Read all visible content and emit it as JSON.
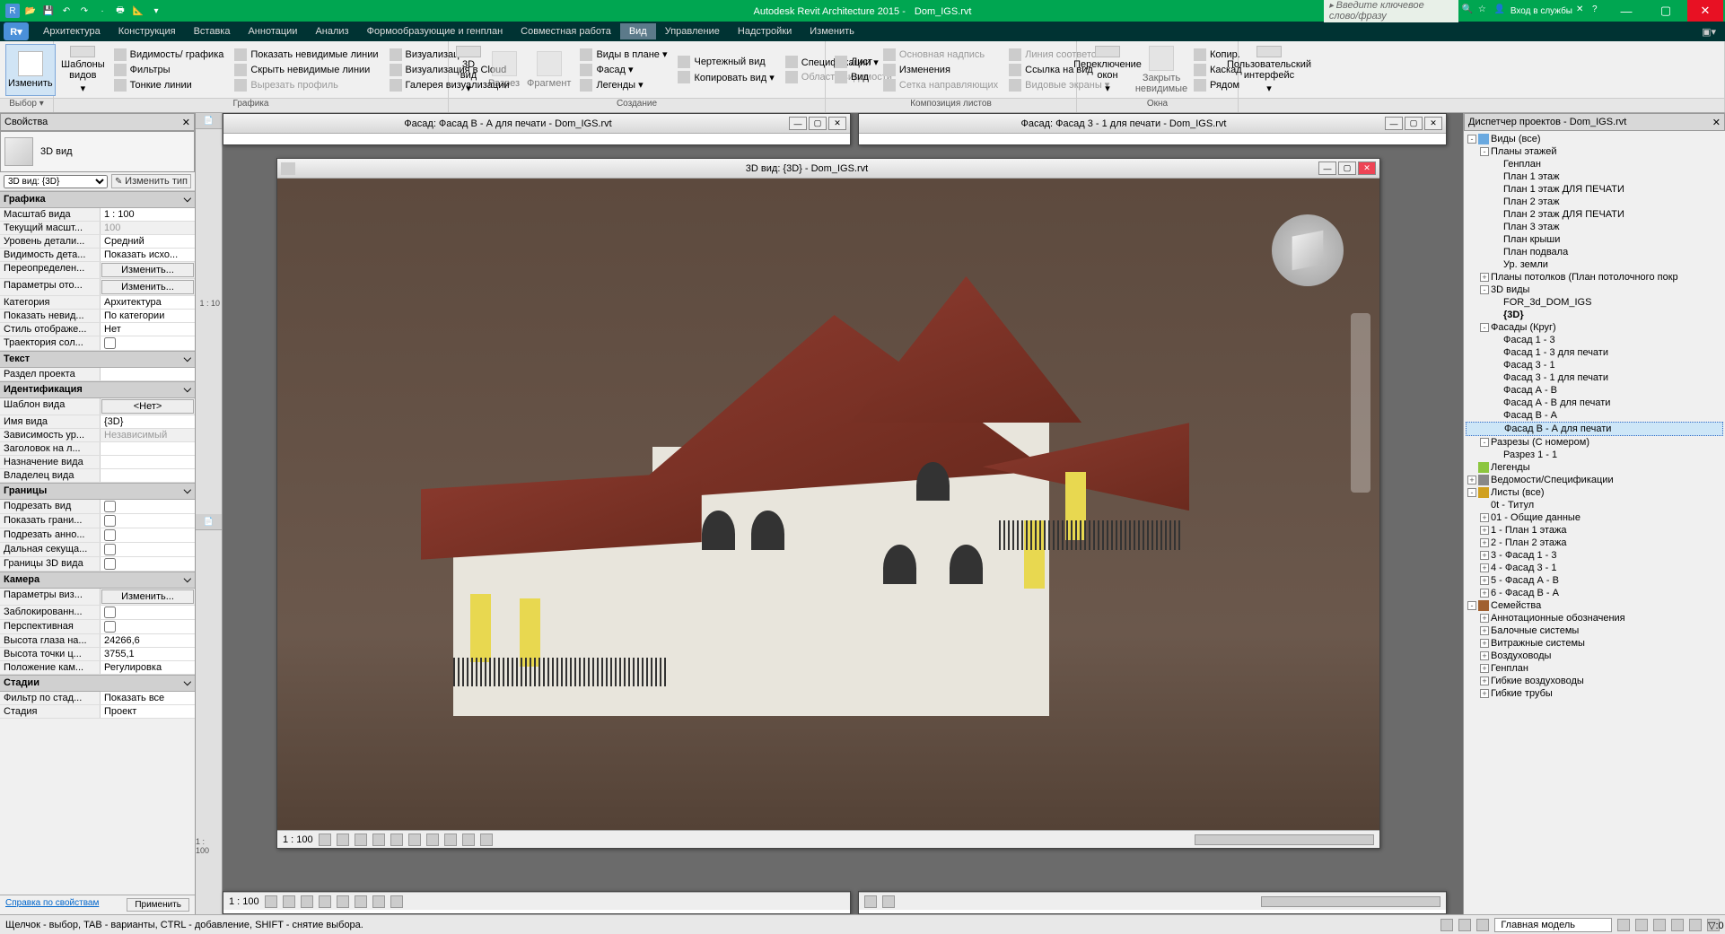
{
  "title_app": "Autodesk Revit Architecture 2015 -",
  "title_file": "Dom_IGS.rvt",
  "search_placeholder": "Введите ключевое слово/фразу",
  "login_label": "Вход в службы",
  "menu_tabs": [
    "Архитектура",
    "Конструкция",
    "Вставка",
    "Аннотации",
    "Анализ",
    "Формообразующие и генплан",
    "Совместная работа",
    "Вид",
    "Управление",
    "Надстройки",
    "Изменить"
  ],
  "menu_active_index": 7,
  "ribbon": {
    "g_select": {
      "label": "Выбор ▾",
      "btn_modify": "Изменить"
    },
    "g_graphics": {
      "label": "Графика",
      "btn_templates": "Шаблоны видов",
      "r1": "Видимость/ графика",
      "r2": "Фильтры",
      "r3": "Тонкие линии",
      "r4": "Показать невидимые линии",
      "r5": "Скрыть невидимые линии",
      "r6": "Вырезать профиль",
      "r7": "Визуализация",
      "r8": "Визуализация  в Cloud",
      "r9": "Галерея  визуализации"
    },
    "g_create": {
      "label": "Создание",
      "btn_3d": "3D вид",
      "btn_section": "Разрез",
      "btn_fragment": "Фрагмент",
      "r1": "Виды в плане  ▾",
      "r2": "Фасад  ▾",
      "r3": "Легенды ▾",
      "r4": "Чертежный вид",
      "r5": "Копировать вид  ▾",
      "r6": "Спецификации  ▾",
      "r7": "Область видимости"
    },
    "g_sheet": {
      "label": "Композиция листов",
      "r1": "Лист",
      "r2": "Вид",
      "r3": "Основная надпись",
      "r4": "Изменения",
      "r5": "Сетка направляющих",
      "r6": "Линия соответствия",
      "r7": "Ссылка на вид",
      "r8": "Видовые экраны  ▾"
    },
    "g_windows": {
      "label": "Окна",
      "btn_switch": "Переключение окон",
      "btn_close": "Закрыть невидимые",
      "r1": "Копир.",
      "r2": "Каскад",
      "r3": "Рядом",
      "btn_ui": "Пользовательский интерфейс"
    }
  },
  "props": {
    "header": "Свойства",
    "type_label": "3D вид",
    "dropdown": "3D вид: {3D}",
    "edit_type": "Изменить тип",
    "cats": {
      "graphics": "Графика",
      "text": "Текст",
      "ident": "Идентификация",
      "bounds": "Границы",
      "camera": "Камера",
      "stages": "Стадии"
    },
    "items": {
      "scale": {
        "k": "Масштаб вида",
        "v": "1 : 100"
      },
      "cur_scale": {
        "k": "Текущий масшт...",
        "v": "100"
      },
      "detail": {
        "k": "Уровень детали...",
        "v": "Средний"
      },
      "visibility": {
        "k": "Видимость дета...",
        "v": "Показать исхо..."
      },
      "override": {
        "k": "Переопределен...",
        "v": "Изменить..."
      },
      "display_params": {
        "k": "Параметры ото...",
        "v": "Изменить..."
      },
      "category": {
        "k": "Категория",
        "v": "Архитектура"
      },
      "show_hidden": {
        "k": "Показать невид...",
        "v": "По категории"
      },
      "disp_style": {
        "k": "Стиль отображе...",
        "v": "Нет"
      },
      "sun_path": {
        "k": "Траектория сол...",
        "v": ""
      },
      "section": {
        "k": "Раздел проекта",
        "v": ""
      },
      "view_tpl": {
        "k": "Шаблон вида",
        "v": "<Нет>"
      },
      "view_name": {
        "k": "Имя вида",
        "v": "{3D}"
      },
      "dependency": {
        "k": "Зависимость ур...",
        "v": "Независимый"
      },
      "title_sheet": {
        "k": "Заголовок на л...",
        "v": ""
      },
      "view_purpose": {
        "k": "Назначение вида",
        "v": ""
      },
      "view_owner": {
        "k": "Владелец вида",
        "v": ""
      },
      "crop_view": {
        "k": "Подрезать вид",
        "v": ""
      },
      "show_crop": {
        "k": "Показать грани...",
        "v": ""
      },
      "crop_anno": {
        "k": "Подрезать анно...",
        "v": ""
      },
      "far_clip": {
        "k": "Дальная секуща...",
        "v": ""
      },
      "bounds_3d": {
        "k": "Границы 3D вида",
        "v": ""
      },
      "render_params": {
        "k": "Параметры виз...",
        "v": "Изменить..."
      },
      "locked": {
        "k": "Заблокированн...",
        "v": ""
      },
      "perspective": {
        "k": "Перспективная",
        "v": ""
      },
      "eye_height": {
        "k": "Высота глаза на...",
        "v": "24266,6"
      },
      "target_height": {
        "k": "Высота точки ц...",
        "v": "3755,1"
      },
      "cam_pos": {
        "k": "Положение кам...",
        "v": "Регулировка"
      },
      "stage_filter": {
        "k": "Фильтр по стад...",
        "v": "Показать все"
      },
      "stage": {
        "k": "Стадия",
        "v": "Проект"
      }
    },
    "help_link": "Справка по свойствам",
    "apply": "Применить"
  },
  "docs": {
    "w1": {
      "title": "Фасад: Фасад В - А для печати - Dom_IGS.rvt"
    },
    "w2": {
      "title": "Фасад: Фасад 3 - 1 для печати - Dom_IGS.rvt"
    },
    "w3": {
      "title": "3D вид: {3D} - Dom_IGS.rvt",
      "scale": "1 : 100"
    }
  },
  "side_scale1": "1 : 10",
  "side_scale2": "1 : 100",
  "browser": {
    "header": "Диспетчер проектов - Dom_IGS.rvt",
    "tree": [
      {
        "ind": 0,
        "tog": "-",
        "label": "Виды (все)",
        "icon": "#6aa9e0"
      },
      {
        "ind": 1,
        "tog": "-",
        "label": "Планы этажей"
      },
      {
        "ind": 2,
        "tog": "",
        "label": "Генплан"
      },
      {
        "ind": 2,
        "tog": "",
        "label": "План 1 этаж"
      },
      {
        "ind": 2,
        "tog": "",
        "label": "План 1 этаж ДЛЯ ПЕЧАТИ"
      },
      {
        "ind": 2,
        "tog": "",
        "label": "План 2 этаж"
      },
      {
        "ind": 2,
        "tog": "",
        "label": "План 2 этаж ДЛЯ ПЕЧАТИ"
      },
      {
        "ind": 2,
        "tog": "",
        "label": "План 3 этаж"
      },
      {
        "ind": 2,
        "tog": "",
        "label": "План крыши"
      },
      {
        "ind": 2,
        "tog": "",
        "label": "План подвала"
      },
      {
        "ind": 2,
        "tog": "",
        "label": "Ур. земли"
      },
      {
        "ind": 1,
        "tog": "+",
        "label": "Планы потолков (План потолочного покр"
      },
      {
        "ind": 1,
        "tog": "-",
        "label": "3D виды"
      },
      {
        "ind": 2,
        "tog": "",
        "label": "FOR_3d_DOM_IGS"
      },
      {
        "ind": 2,
        "tog": "",
        "label": "{3D}",
        "bold": true
      },
      {
        "ind": 1,
        "tog": "-",
        "label": "Фасады (Круг)"
      },
      {
        "ind": 2,
        "tog": "",
        "label": "Фасад 1 - 3"
      },
      {
        "ind": 2,
        "tog": "",
        "label": "Фасад 1 - 3 для печати"
      },
      {
        "ind": 2,
        "tog": "",
        "label": "Фасад 3 - 1"
      },
      {
        "ind": 2,
        "tog": "",
        "label": "Фасад 3 - 1 для печати"
      },
      {
        "ind": 2,
        "tog": "",
        "label": "Фасад А - В"
      },
      {
        "ind": 2,
        "tog": "",
        "label": "Фасад А - В для печати"
      },
      {
        "ind": 2,
        "tog": "",
        "label": "Фасад В - А"
      },
      {
        "ind": 2,
        "tog": "",
        "label": "Фасад В - А для печати",
        "selected": true
      },
      {
        "ind": 1,
        "tog": "-",
        "label": "Разрезы (С номером)"
      },
      {
        "ind": 2,
        "tog": "",
        "label": "Разрез 1 - 1"
      },
      {
        "ind": 0,
        "tog": "",
        "label": "Легенды",
        "icon": "#8cc63f"
      },
      {
        "ind": 0,
        "tog": "+",
        "label": "Ведомости/Спецификации",
        "icon": "#888"
      },
      {
        "ind": 0,
        "tog": "-",
        "label": "Листы (все)",
        "icon": "#d0a020"
      },
      {
        "ind": 1,
        "tog": "",
        "label": "0t - Титул"
      },
      {
        "ind": 1,
        "tog": "+",
        "label": "01 - Общие данные"
      },
      {
        "ind": 1,
        "tog": "+",
        "label": "1 - План 1 этажа"
      },
      {
        "ind": 1,
        "tog": "+",
        "label": "2 - План 2 этажа"
      },
      {
        "ind": 1,
        "tog": "+",
        "label": "3 - Фасад 1 - 3"
      },
      {
        "ind": 1,
        "tog": "+",
        "label": "4 - Фасад 3 - 1"
      },
      {
        "ind": 1,
        "tog": "+",
        "label": "5 - Фасад А - В"
      },
      {
        "ind": 1,
        "tog": "+",
        "label": "6 - Фасад В - А"
      },
      {
        "ind": 0,
        "tog": "-",
        "label": "Семейства",
        "icon": "#a06030"
      },
      {
        "ind": 1,
        "tog": "+",
        "label": "Аннотационные обозначения"
      },
      {
        "ind": 1,
        "tog": "+",
        "label": "Балочные системы"
      },
      {
        "ind": 1,
        "tog": "+",
        "label": "Витражные системы"
      },
      {
        "ind": 1,
        "tog": "+",
        "label": "Воздуховоды"
      },
      {
        "ind": 1,
        "tog": "+",
        "label": "Генплан"
      },
      {
        "ind": 1,
        "tog": "+",
        "label": "Гибкие воздуховоды"
      },
      {
        "ind": 1,
        "tog": "+",
        "label": "Гибкие трубы"
      }
    ]
  },
  "status": {
    "left": "Щелчок - выбор, TAB - варианты, CTRL - добавление, SHIFT - снятие выбора.",
    "model": "Главная модель"
  }
}
